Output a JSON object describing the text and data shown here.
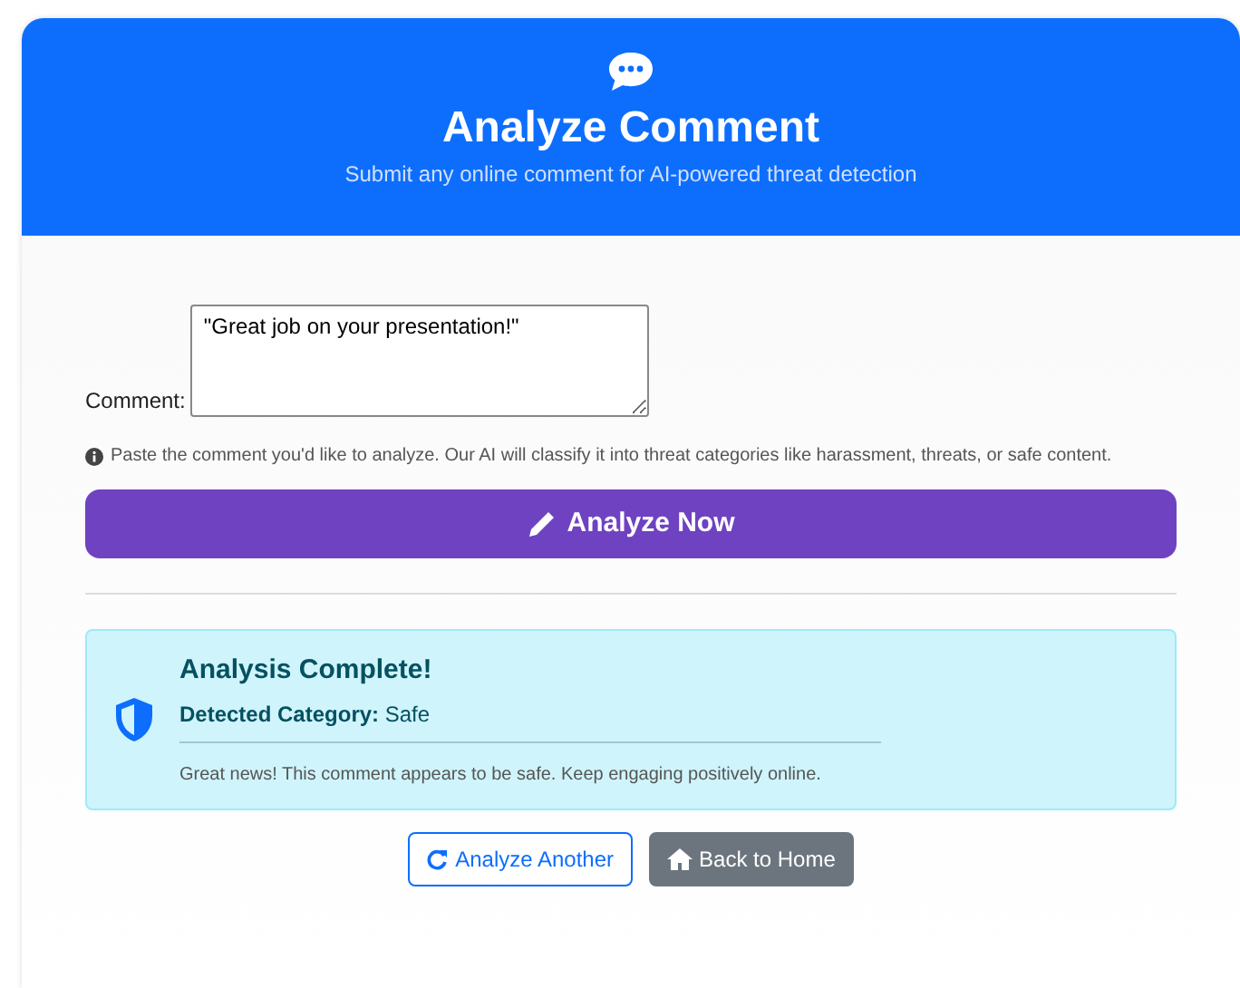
{
  "header": {
    "title": "Analyze Comment",
    "subtitle": "Submit any online comment for AI-powered threat detection"
  },
  "form": {
    "label": "Comment:",
    "value": "\"Great job on your presentation!\"",
    "hint": "Paste the comment you'd like to analyze. Our AI will classify it into threat categories like harassment, threats, or safe content.",
    "submit": "Analyze Now"
  },
  "result": {
    "title": "Analysis Complete!",
    "category": "**Detected Category:** Safe",
    "message": "Great news! This comment appears to be safe. Keep engaging positively online."
  },
  "actions": [
    {
      "label": "Analyze Another",
      "kind": "outline"
    },
    {
      "label": "Back to Home",
      "kind": "secondary"
    }
  ]
}
